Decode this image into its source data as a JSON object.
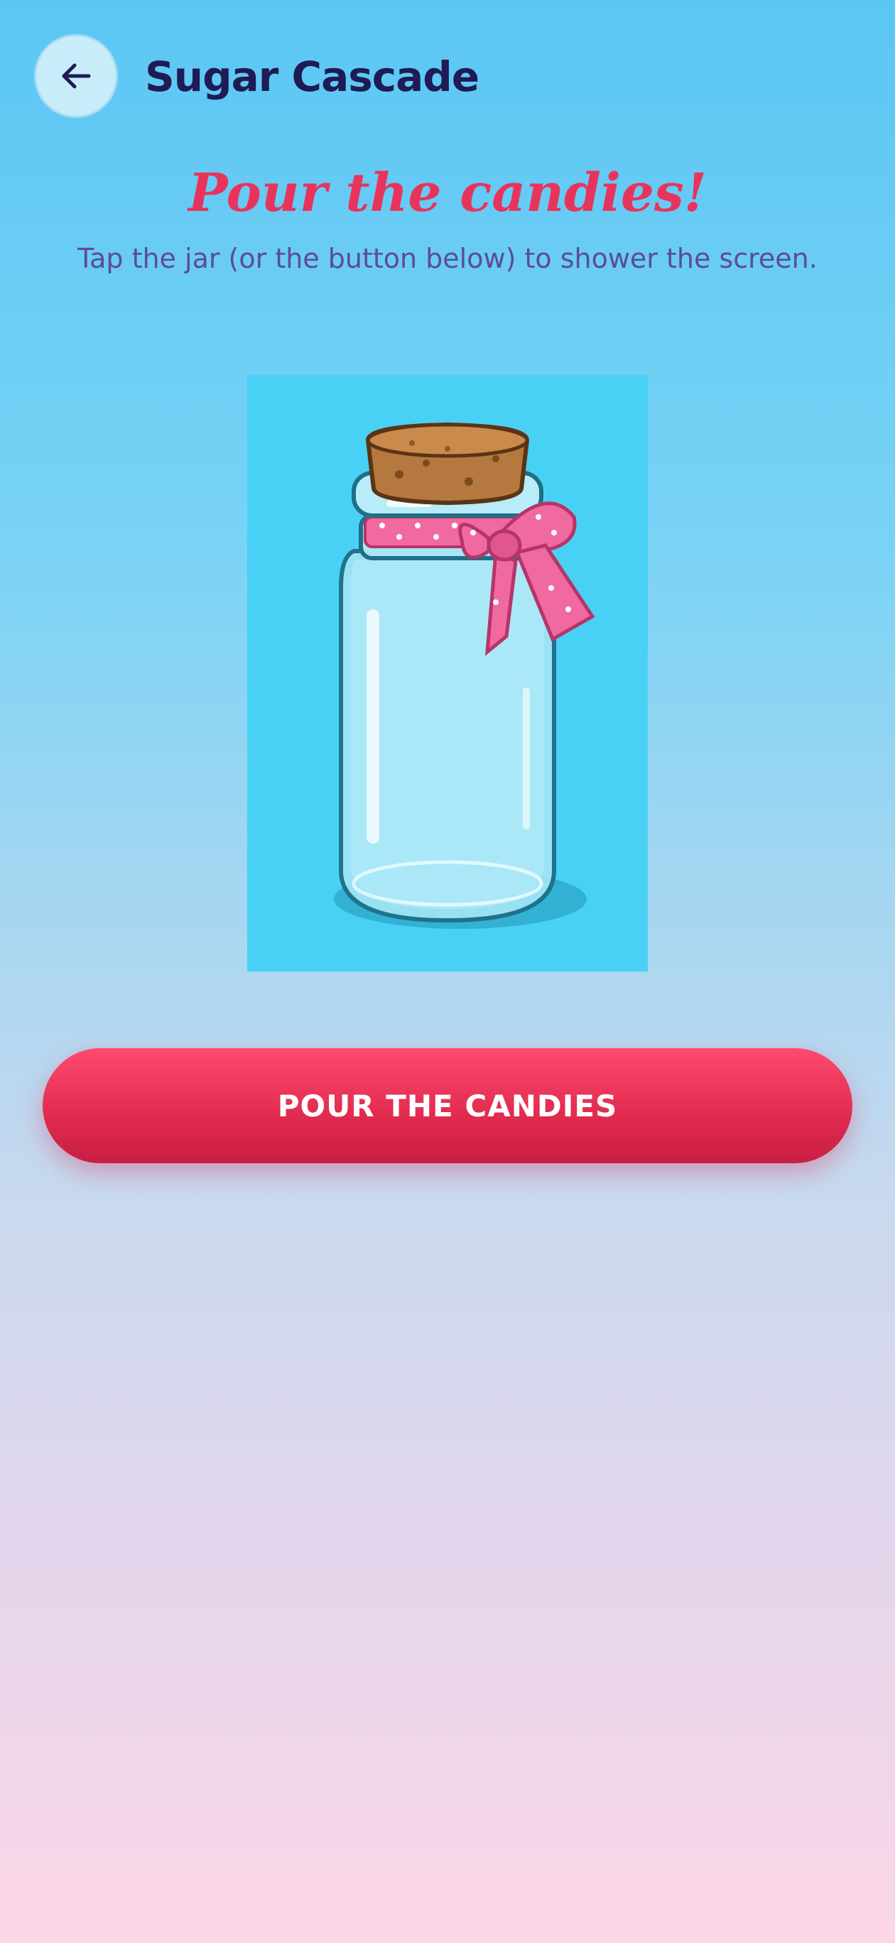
{
  "header": {
    "back_icon": "arrow-left-icon",
    "title": "Sugar Cascade"
  },
  "main": {
    "headline": "Pour the candies!",
    "instruction": "Tap the jar (or the button below) to shower the screen.",
    "jar_image": "candy-jar-with-cork-and-pink-bow",
    "pour_button_label": "POUR THE CANDIES"
  },
  "colors": {
    "accent": "#e8345c",
    "title": "#1f1b55",
    "subtext": "#5c4d92",
    "button": "#e02a4e"
  }
}
